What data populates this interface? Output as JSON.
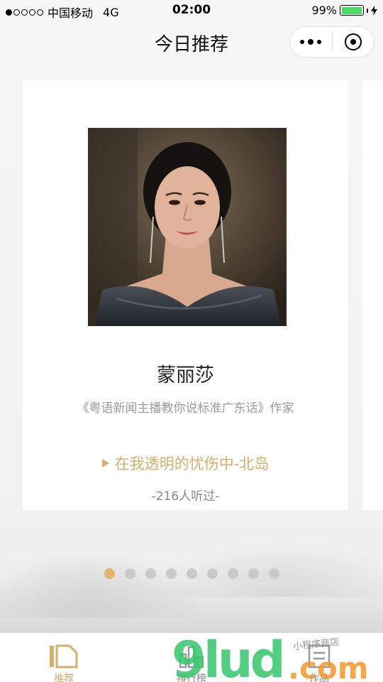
{
  "status_bar": {
    "carrier": "中国移动",
    "network": "4G",
    "time": "02:00",
    "battery_percent": "99%",
    "battery_level": 0.99
  },
  "nav": {
    "title": "今日推荐"
  },
  "card": {
    "author_name": "蒙丽莎",
    "author_description": "《粤语新闻主播教你说标准广东话》作家",
    "track_title": "在我透明的忧伤中-北岛",
    "listen_count": "-216人听过-"
  },
  "pagination": {
    "total": 9,
    "active_index": 0
  },
  "tab_bar": {
    "items": [
      {
        "label": "推荐",
        "icon": "recommend-icon",
        "active": true
      },
      {
        "label": "排行榜",
        "icon": "ranking-icon",
        "active": false
      },
      {
        "label": "作品",
        "icon": "works-icon",
        "active": false
      }
    ]
  },
  "watermark": {
    "brand": "9lud",
    "domain": ".com",
    "tagline": "小程序商店"
  },
  "colors": {
    "accent": "#d4ae6c",
    "dot_active": "#e2b46e",
    "dot_inactive": "#c9c9c9",
    "battery": "#4cd964"
  }
}
